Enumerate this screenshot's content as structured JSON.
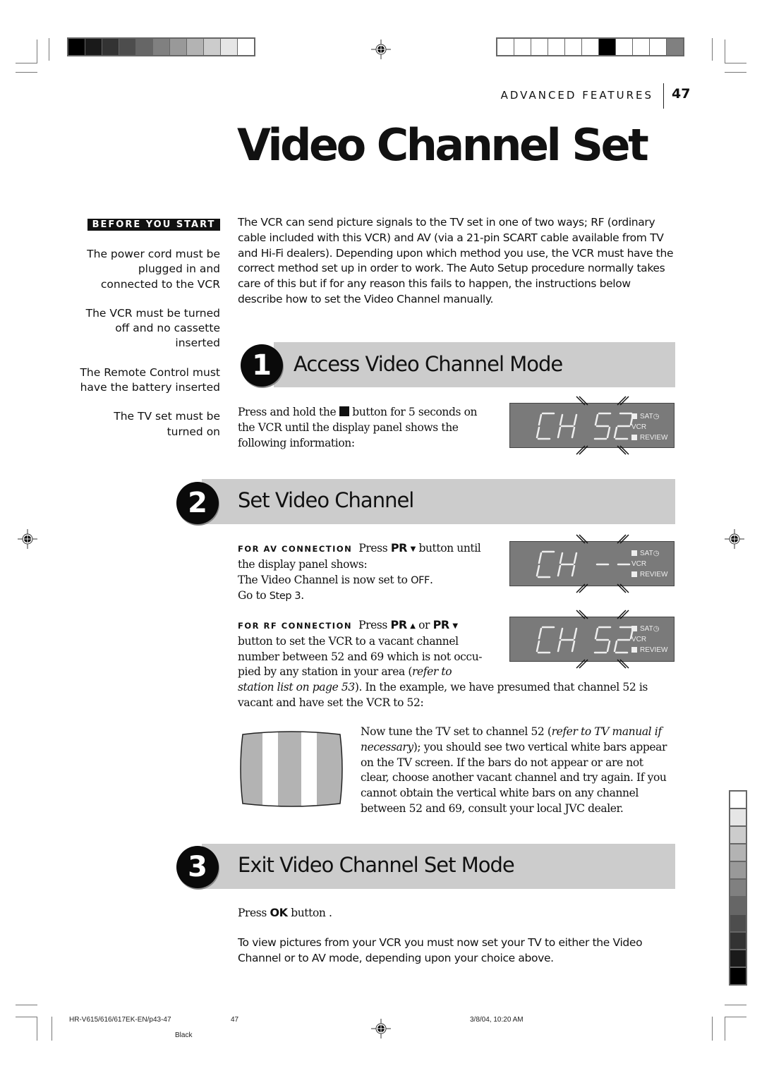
{
  "header": {
    "section": "ADVANCED FEATURES",
    "page_number": "47"
  },
  "title": "Video Channel Set",
  "sidebar": {
    "heading": "BEFORE YOU START",
    "items": [
      "The power cord must be plugged in and connected to the VCR",
      "The VCR must be turned off and no cassette inserted",
      "The Remote Control must have the battery inserted",
      "The TV set must be turned on"
    ]
  },
  "intro": "The VCR can send picture signals to the TV set in one of two ways; RF (ordinary cable included with this VCR) and AV (via a 21-pin SCART cable available from TV and Hi-Fi dealers). Depending upon which method you use, the VCR must have the correct method set up in order to work. The Auto Setup procedure normally takes care of this but if for any reason this fails to happen, the instructions below describe how to set the Video Channel manually.",
  "steps": [
    {
      "number": "1",
      "title": "Access Video Channel Mode",
      "text_before_icon": "Press and hold the",
      "stop_icon": "stop-button-icon",
      "text_after_icon": "button for 5 seconds on the VCR until the display panel shows the following information:",
      "display": {
        "main": "CH 52",
        "indicators": [
          "SAT",
          "VCR",
          "REVIEW"
        ],
        "timer_icon": "clock-icon"
      }
    },
    {
      "number": "2",
      "title": "Set Video Channel",
      "av": {
        "label": "FOR AV CONNECTION",
        "press": "Press",
        "key": "PR",
        "key_arrow": "▼",
        "rest": "button until the display panel shows:",
        "line2_pre": "The Video Channel is now set to",
        "line2_value": "OFF",
        "line3_pre": "Go to",
        "line3_value": "Step 3",
        "display": {
          "main": "CH --",
          "indicators": [
            "SAT",
            "VCR",
            "REVIEW"
          ]
        }
      },
      "rf": {
        "label": "FOR RF CONNECTION",
        "press": "Press",
        "key_up": "PR",
        "arrow_up": "▲",
        "or": "or",
        "key_down": "PR",
        "arrow_down": "▼",
        "text1": "button to set the VCR to a vacant channel number between 52 and 69 which is not occu-pied by any station in your area (",
        "italic1": "refer to station list on page 53",
        "text2": "). In the example, we have presumed that channel 52 is vacant and have set the VCR to 52:",
        "display": {
          "main": "CH 52",
          "indicators": [
            "SAT",
            "VCR",
            "REVIEW"
          ]
        }
      },
      "tv_text_1": "Now tune the TV set to channel 52 (",
      "tv_italic": "refer to TV manual if necessary",
      "tv_text_2": "); you should see two vertical white bars appear on the TV screen. If the bars do not appear or are not clear, choose another vacant channel and try again. If you cannot obtain the vertical white bars on any channel between 52 and 69, consult your local JVC dealer."
    },
    {
      "number": "3",
      "title": "Exit Video Channel Set Mode",
      "press": "Press",
      "key": "OK",
      "rest": "button ."
    }
  ],
  "closing": "To view pictures from your VCR you must now set your TV to either the Video Channel or to AV mode, depending upon your choice above.",
  "footer": {
    "file": "HR-V615/616/617EK-EN/p43-47",
    "page": "47",
    "date": "3/8/04, 10:20 AM",
    "plate": "Black"
  },
  "colors": {
    "step_bar": "#cccccc",
    "lcd_bg": "#7a7a7a",
    "lcd_fg": "#eeeeee",
    "tv_screen": "#b3b3b3",
    "grayscale_top": [
      "#000000",
      "#1a1a1a",
      "#333333",
      "#4d4d4d",
      "#666666",
      "#808080",
      "#999999",
      "#b3b3b3",
      "#cccccc",
      "#e6e6e6",
      "#ffffff"
    ],
    "registration_top_right": [
      "#ffffff",
      "#ffffff",
      "#ffffff",
      "#ffffff",
      "#ffffff",
      "#ffffff",
      "#000000",
      "#ffffff",
      "#ffffff",
      "#ffffff",
      "#808080"
    ],
    "grayscale_side": [
      "#ffffff",
      "#e6e6e6",
      "#cccccc",
      "#b3b3b3",
      "#999999",
      "#808080",
      "#666666",
      "#4d4d4d",
      "#333333",
      "#1a1a1a",
      "#000000"
    ]
  }
}
